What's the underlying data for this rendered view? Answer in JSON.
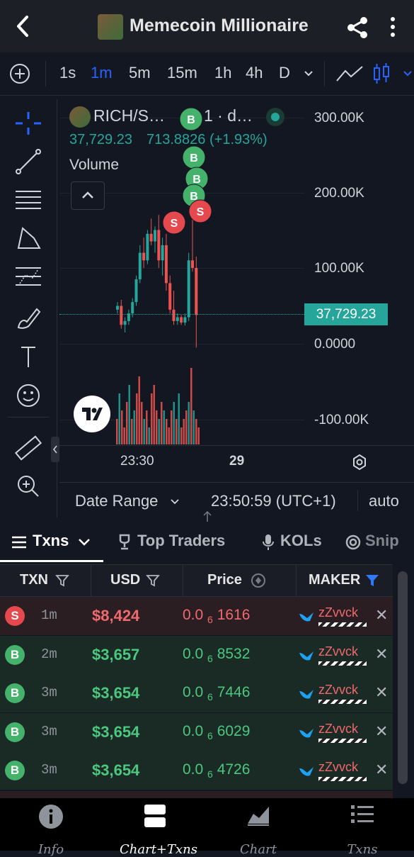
{
  "header": {
    "title": "Memecoin Millionaire",
    "back_icon": "arrow-left-icon",
    "share_icon": "share-icon",
    "more_icon": "more-vertical-icon"
  },
  "timeframes": {
    "items": [
      "1s",
      "1m",
      "5m",
      "15m",
      "1h",
      "4h",
      "D"
    ],
    "active": "1m"
  },
  "chart": {
    "symbol": "RICH/S…",
    "interval": "1 · d…",
    "last_price": "37,729.23",
    "change": "713.8826 (+1.93%)",
    "volume_label": "Volume",
    "price_tag": "37,729.23",
    "price_axis": [
      "300.00K",
      "200.00K",
      "100.00K",
      "0.0000",
      "-100.00K"
    ],
    "time_labels": [
      "23:30",
      "29"
    ],
    "date_range_label": "Date Range",
    "clock": "23:50:59 (UTC+1)",
    "scale_mode": "auto",
    "colors": {
      "up": "#26a69a",
      "down": "#ef5350",
      "buy": "#45b26b",
      "sell": "#e5484d"
    }
  },
  "chart_data": {
    "type": "candlestick",
    "series": [
      {
        "name": "Volume",
        "values": [
          3,
          6,
          4,
          2,
          5,
          7,
          3,
          4,
          6,
          8,
          5,
          3,
          4,
          2,
          6,
          7,
          4,
          3,
          5,
          4,
          3,
          2,
          4,
          5,
          3,
          6,
          2,
          3,
          4,
          5,
          9,
          4,
          3,
          2
        ]
      }
    ],
    "candles": [
      {
        "o": 45,
        "h": 55,
        "l": 40,
        "c": 50
      },
      {
        "o": 50,
        "h": 58,
        "l": 20,
        "c": 25
      },
      {
        "o": 25,
        "h": 35,
        "l": 15,
        "c": 30
      },
      {
        "o": 30,
        "h": 45,
        "l": 25,
        "c": 40
      },
      {
        "o": 40,
        "h": 60,
        "l": 35,
        "c": 55
      },
      {
        "o": 55,
        "h": 90,
        "l": 50,
        "c": 85
      },
      {
        "o": 85,
        "h": 130,
        "l": 80,
        "c": 120
      },
      {
        "o": 120,
        "h": 140,
        "l": 100,
        "c": 110
      },
      {
        "o": 110,
        "h": 150,
        "l": 105,
        "c": 145
      },
      {
        "o": 145,
        "h": 165,
        "l": 130,
        "c": 135
      },
      {
        "o": 135,
        "h": 155,
        "l": 120,
        "c": 150
      },
      {
        "o": 150,
        "h": 170,
        "l": 100,
        "c": 110
      },
      {
        "o": 110,
        "h": 140,
        "l": 90,
        "c": 130
      },
      {
        "o": 130,
        "h": 145,
        "l": 70,
        "c": 80
      },
      {
        "o": 80,
        "h": 90,
        "l": 40,
        "c": 45
      },
      {
        "o": 45,
        "h": 70,
        "l": 25,
        "c": 30
      },
      {
        "o": 30,
        "h": 40,
        "l": 25,
        "c": 35
      },
      {
        "o": 35,
        "h": 38,
        "l": 25,
        "c": 28
      },
      {
        "o": 28,
        "h": 40,
        "l": 24,
        "c": 35
      },
      {
        "o": 35,
        "h": 120,
        "l": 30,
        "c": 110
      },
      {
        "o": 110,
        "h": 180,
        "l": 95,
        "c": 100
      },
      {
        "o": 100,
        "h": 115,
        "l": -5,
        "c": 38
      }
    ],
    "markers": [
      {
        "type": "B",
        "i": 18
      },
      {
        "type": "B",
        "i": 18
      },
      {
        "type": "B",
        "i": 18
      },
      {
        "type": "B",
        "i": 18
      },
      {
        "type": "S",
        "i": 12
      },
      {
        "type": "S",
        "i": 20
      }
    ],
    "ylim": [
      -100000,
      300000
    ],
    "yticks": [
      "300.00K",
      "200.00K",
      "100.00K",
      "0.0000",
      "-100.00K"
    ],
    "xticks": [
      "23:30",
      "29"
    ]
  },
  "tabs": [
    {
      "label": "Txns",
      "icon": "list-icon",
      "active": true
    },
    {
      "label": "Top Traders",
      "icon": "trophy-icon"
    },
    {
      "label": "KOLs",
      "icon": "microphone-icon"
    },
    {
      "label": "Snip",
      "icon": "target-icon"
    }
  ],
  "table": {
    "headers": {
      "txn": "TXN",
      "usd": "USD",
      "price": "Price",
      "maker": "MAKER"
    },
    "rows": [
      {
        "type": "S",
        "age": "1m",
        "usd": "$8,424",
        "price_prefix": "0.0",
        "price_sub": "6",
        "price_tail": "1616",
        "maker": "zZvvck"
      },
      {
        "type": "B",
        "age": "2m",
        "usd": "$3,657",
        "price_prefix": "0.0",
        "price_sub": "6",
        "price_tail": "8532",
        "maker": "zZvvck"
      },
      {
        "type": "B",
        "age": "3m",
        "usd": "$3,654",
        "price_prefix": "0.0",
        "price_sub": "6",
        "price_tail": "7446",
        "maker": "zZvvck"
      },
      {
        "type": "B",
        "age": "3m",
        "usd": "$3,654",
        "price_prefix": "0.0",
        "price_sub": "6",
        "price_tail": "6029",
        "maker": "zZvvck"
      },
      {
        "type": "B",
        "age": "3m",
        "usd": "$3,654",
        "price_prefix": "0.0",
        "price_sub": "6",
        "price_tail": "4726",
        "maker": "zZvvck"
      }
    ]
  },
  "nav": [
    {
      "label": "Info",
      "icon": "info-icon"
    },
    {
      "label": "Chart+Txns",
      "icon": "split-view-icon",
      "active": true
    },
    {
      "label": "Chart",
      "icon": "area-chart-icon"
    },
    {
      "label": "Txns",
      "icon": "list-icon"
    }
  ]
}
